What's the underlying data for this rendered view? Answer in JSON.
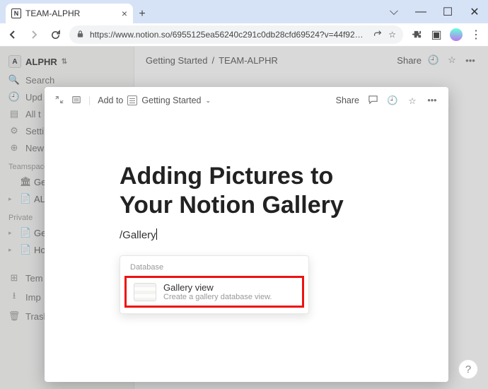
{
  "browser": {
    "tab_title": "TEAM-ALPHR",
    "url": "https://www.notion.so/6955125ea56240c291c0db28cfd69524?v=44f92629c3…"
  },
  "sidebar": {
    "workspace": "ALPHR",
    "items": [
      {
        "icon": "🔍",
        "label": "Search"
      },
      {
        "icon": "🕘",
        "label": "Upd"
      },
      {
        "icon": "▤",
        "label": "All t"
      },
      {
        "icon": "⚙",
        "label": "Setti"
      },
      {
        "icon": "⊕",
        "label": "New"
      }
    ],
    "group1_label": "Teamspace",
    "teamspace_pages": [
      {
        "icon": "🏛",
        "label": "Gen"
      },
      {
        "icon": "📄",
        "label": "AL"
      }
    ],
    "group2_label": "Private",
    "private_pages": [
      {
        "icon": "📄",
        "label": "Ge"
      },
      {
        "icon": "📄",
        "label": "Ho"
      }
    ],
    "footer_items": [
      {
        "icon": "⊞",
        "label": "Tem"
      },
      {
        "icon": "⭳",
        "label": "Imp"
      },
      {
        "icon": "🗑",
        "label": "Trasl"
      }
    ]
  },
  "topbar": {
    "breadcrumb1": "Getting Started",
    "breadcrumb2": "TEAM-ALPHR",
    "share": "Share"
  },
  "modal": {
    "add_to_label": "Add to",
    "add_to_target": "Getting Started",
    "share": "Share",
    "title_line1": "Adding Pictures to",
    "title_line2": "Your Notion Gallery",
    "typed_text": "/Gallery"
  },
  "slash_menu": {
    "group_label": "Database",
    "item_title": "Gallery view",
    "item_desc": "Create a gallery database view."
  },
  "help_label": "?"
}
